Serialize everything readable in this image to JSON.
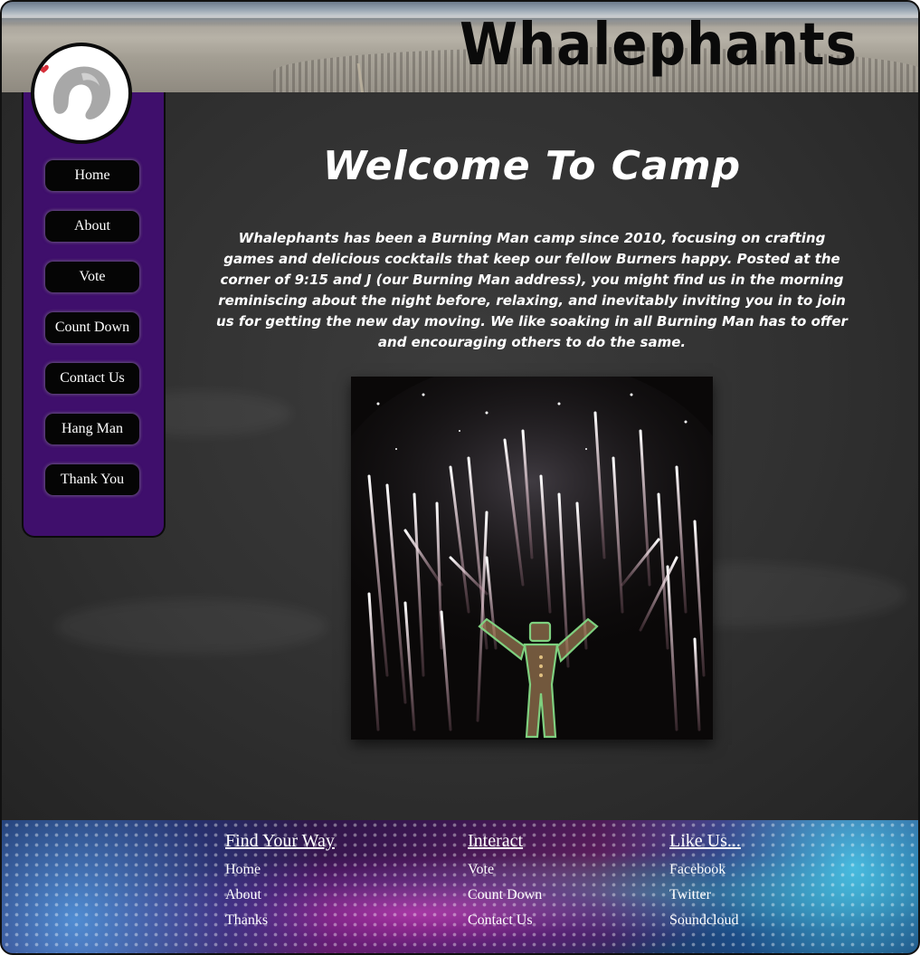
{
  "site": {
    "title": "Whalephants"
  },
  "nav": {
    "items": [
      {
        "label": "Home"
      },
      {
        "label": "About"
      },
      {
        "label": "Vote"
      },
      {
        "label": "Count Down"
      },
      {
        "label": "Contact Us"
      },
      {
        "label": "Hang Man"
      },
      {
        "label": "Thank You"
      }
    ]
  },
  "main": {
    "heading": "Welcome To Camp",
    "intro": "Whalephants has been a Burning Man camp since 2010, focusing on crafting games and delicious cocktails that keep our fellow Burners happy. Posted at the corner of 9:15 and J (our Burning Man address), you might find us in the morning reminiscing about the night before, relaxing, and inevitably inviting you in to join us for getting the new day moving. We like soaking in all Burning Man has to offer and encouraging others to do the same."
  },
  "footer": {
    "columns": [
      {
        "title": "Find Your Way",
        "links": [
          "Home",
          "About",
          "Thanks"
        ]
      },
      {
        "title": "Interact",
        "links": [
          "Vote",
          "Count Down",
          "Contact Us"
        ]
      },
      {
        "title": "Like Us...",
        "links": [
          "Facebook",
          "Twitter",
          "Soundcloud"
        ]
      }
    ]
  },
  "colors": {
    "sidebar": "#3f0f6c",
    "chalkboard": "#2c2c2c",
    "nav_button": "#050505",
    "logo_heart": "#d6303a"
  },
  "icons": {
    "logo": "whalephant-logo-icon"
  }
}
